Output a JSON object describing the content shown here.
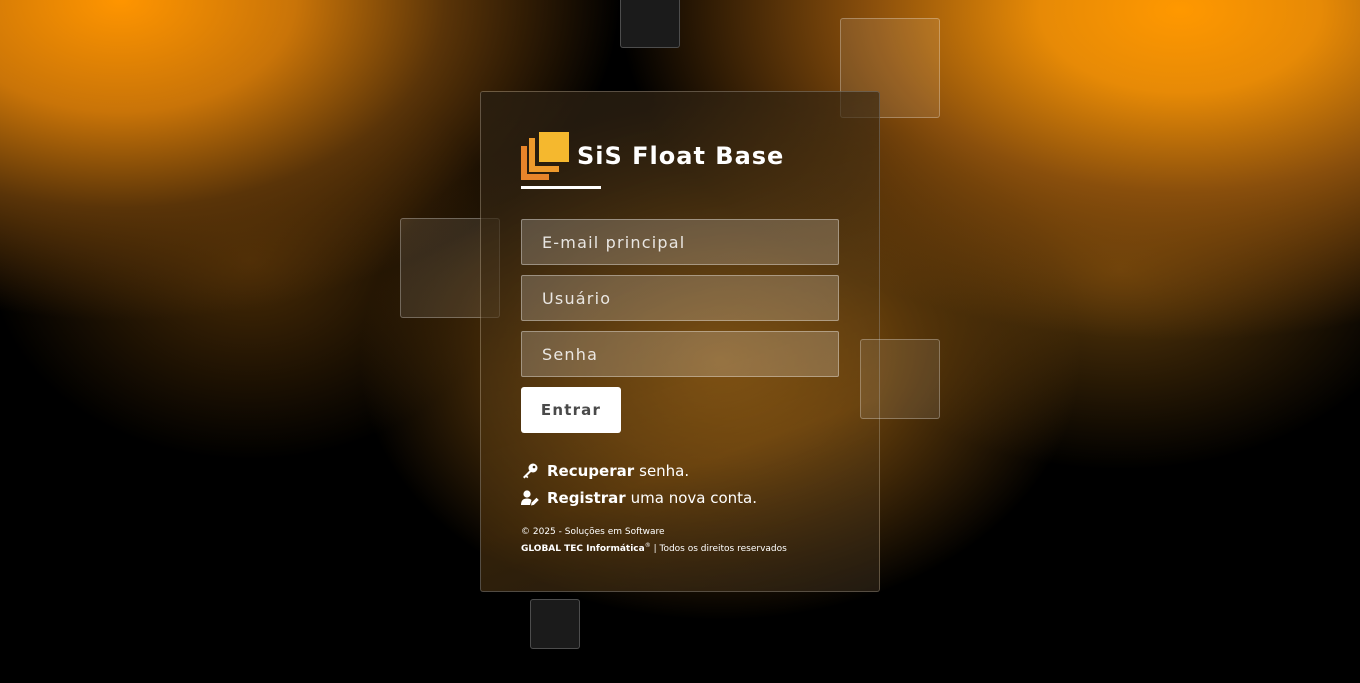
{
  "brand": {
    "title": "SiS Float Base",
    "logo_colors": {
      "front": "#f5b82e",
      "back": "#e8842a"
    }
  },
  "form": {
    "email_placeholder": "E-mail principal",
    "user_placeholder": "Usuário",
    "password_placeholder": "Senha",
    "submit_label": "Entrar"
  },
  "links": {
    "recover": {
      "icon": "key-icon",
      "bold": "Recuperar",
      "rest": "senha."
    },
    "register": {
      "icon": "user-edit-icon",
      "bold": "Registrar",
      "rest": "uma nova conta."
    }
  },
  "footer": {
    "line1": "© 2025 - Soluções em Software",
    "company": "GLOBAL TEC Informática",
    "reg": "®",
    "rights": " | Todos os direitos reservados"
  },
  "colors": {
    "accent": "#ff9800",
    "button_bg": "#ffffff",
    "button_text": "#4a4a4a"
  }
}
